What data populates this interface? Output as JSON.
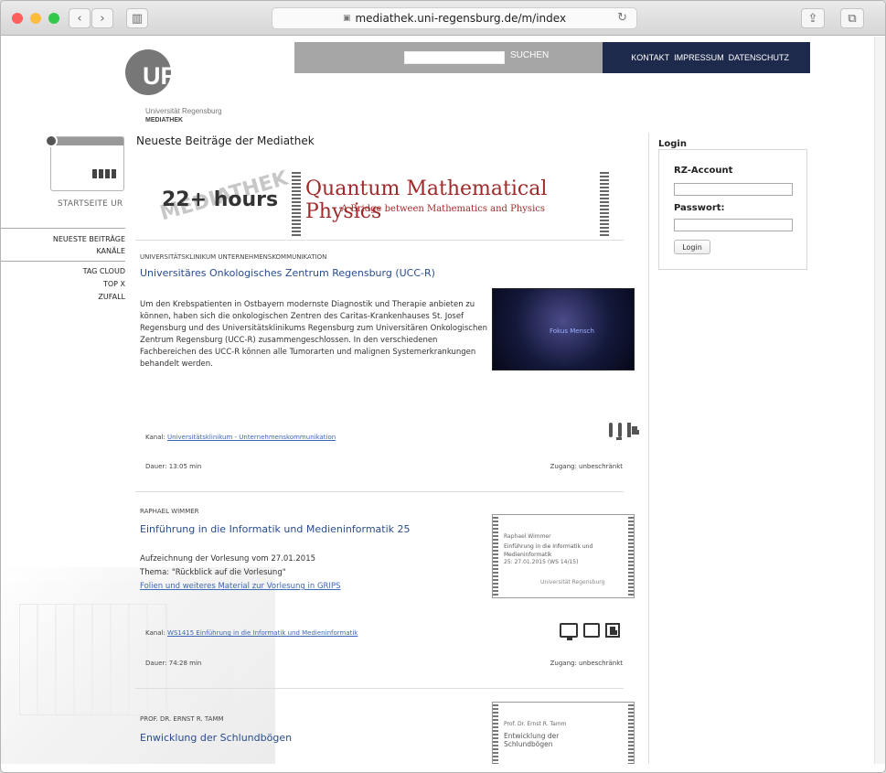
{
  "browser": {
    "url": "mediathek.uni-regensburg.de/m/index"
  },
  "header": {
    "search_label": "SUCHEN",
    "nav": [
      "KONTAKT",
      "IMPRESSUM",
      "DATENSCHUTZ"
    ],
    "logo_mark": "UR",
    "logo_line1": "Universität Regensburg",
    "logo_line2": "MEDIATHEK"
  },
  "sidebar": {
    "home": "STARTSEITE UR",
    "items": [
      "NEUESTE BEITRÄGE",
      "KANÄLE",
      "TAG CLOUD",
      "TOP X",
      "ZUFALL"
    ]
  },
  "main": {
    "title": "Neueste Beiträge der Mediathek"
  },
  "banner": {
    "watermark": "MEDIATHEK",
    "hours": "22+ hours",
    "title": "Quantum Mathematical Physics",
    "subtitle": "A Bridge between Mathematics and Physics"
  },
  "entries": [
    {
      "meta": "UNIVERSITÄTSKLINIKUM UNTERNEHMENSKOMMUNIKATION",
      "title": "Universitäres Onkologisches Zentrum Regensburg (UCC-R)",
      "text": "Um den Krebspatienten in Ostbayern modernste Diagnostik und Therapie anbieten zu können, haben sich die onkologischen Zentren des Caritas-Krankenhauses St. Josef Regensburg und des Universitätsklinikums Regensburg zum Universitären Onkologischen Zentrum Regensburg (UCC-R) zusammengeschlossen. In den verschiedenen Fachbereichen des UCC-R können alle Tumorarten und malignen Systemerkrankungen behandelt werden.",
      "kanal_label": "Kanal:",
      "kanal": "Universitätsklinikum - Unternehmenskommunikation",
      "dauer": "Dauer: 13:05 min",
      "zugang": "Zugang: unbeschränkt",
      "thumb_title": "Fokus Mensch"
    },
    {
      "meta": "RAPHAEL WIMMER",
      "title": "Einführung in die Informatik und Medieninformatik 25",
      "text1": "Aufzeichnung der Vorlesung vom 27.01.2015",
      "text2": "Thema: \"Rückblick auf die Vorlesung\"",
      "link": "Folien und weiteres Material zur Vorlesung in GRIPS",
      "kanal_label": "Kanal:",
      "kanal": "WS1415 Einführung in die Informatik und Medieninformatik",
      "dauer": "Dauer: 74:28 min",
      "zugang": "Zugang: unbeschränkt",
      "thumb_speaker": "Raphael Wimmer",
      "thumb_title": "Einführung in die Informatik und Medieninformatik",
      "thumb_date": "25: 27.01.2015 (WS 14/15)",
      "thumb_brand": "Universität Regensburg"
    },
    {
      "meta": "PROF. DR. ERNST R. TAMM",
      "title": "Enwicklung der Schlundbögen",
      "thumb_speaker": "Prof. Dr. Ernst R. Tamm",
      "thumb_title": "Entwicklung der Schlundbögen"
    }
  ],
  "login": {
    "title": "Login",
    "account_label": "RZ-Account",
    "password_label": "Passwort:",
    "button": "Login"
  }
}
